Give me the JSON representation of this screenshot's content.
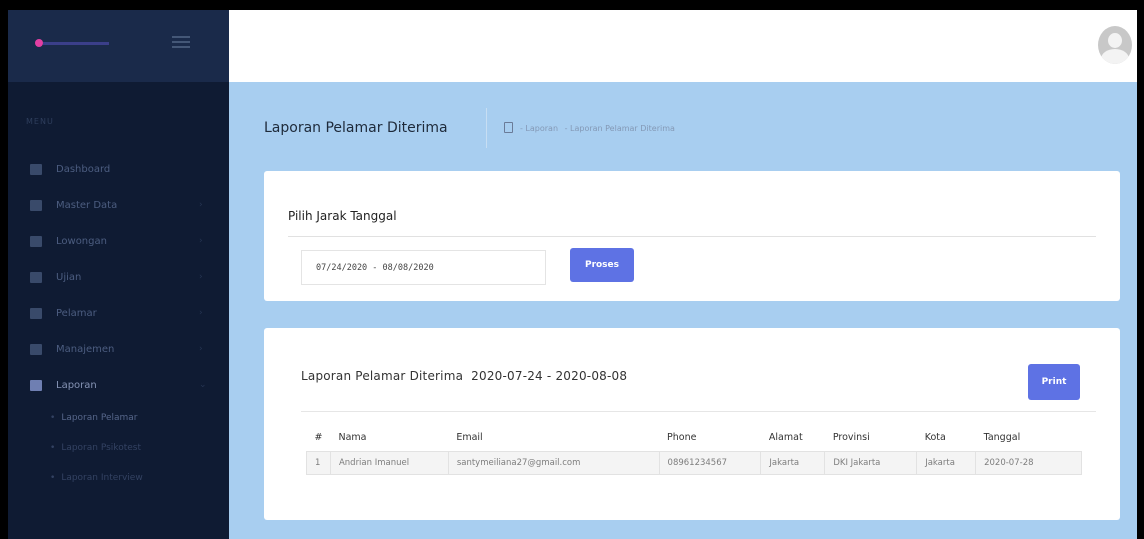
{
  "sidebar": {
    "menu_label": "MENU",
    "items": [
      {
        "label": "Dashboard",
        "icon": "home-icon",
        "has_chevron": false
      },
      {
        "label": "Master Data",
        "icon": "folder-icon",
        "has_chevron": true
      },
      {
        "label": "Lowongan",
        "icon": "briefcase-icon",
        "has_chevron": true
      },
      {
        "label": "Ujian",
        "icon": "archive-icon",
        "has_chevron": true
      },
      {
        "label": "Pelamar",
        "icon": "id-card-icon",
        "has_chevron": true
      },
      {
        "label": "Manajemen",
        "icon": "gear-icon",
        "has_chevron": true
      },
      {
        "label": "Laporan",
        "icon": "folder-open-icon",
        "has_chevron": true
      }
    ],
    "sub_items": [
      {
        "label": "Laporan Pelamar"
      },
      {
        "label": "Laporan Psikotest"
      },
      {
        "label": "Laporan Interview"
      }
    ]
  },
  "header": {
    "title": "Laporan Pelamar Diterima",
    "breadcrumb": [
      "- Laporan",
      "- Laporan Pelamar Diterima"
    ]
  },
  "filter": {
    "title": "Pilih Jarak Tanggal",
    "date_range": "07/24/2020 - 08/08/2020",
    "button": "Proses"
  },
  "report": {
    "title": "Laporan Pelamar Diterima",
    "range": "2020-07-24 - 2020-08-08",
    "print_button": "Print",
    "columns": [
      "#",
      "Nama",
      "Email",
      "Phone",
      "Alamat",
      "Provinsi",
      "Kota",
      "Tanggal"
    ],
    "rows": [
      [
        "1",
        "Andrian Imanuel",
        "santymeiliana27@gmail.com",
        "08961234567",
        "Jakarta",
        "DKI Jakarta",
        "Jakarta",
        "2020-07-28"
      ]
    ]
  },
  "colors": {
    "accent": "#5e72e4",
    "sidebar_bg": "#0f1b33",
    "content_bg": "#a8cef0"
  }
}
